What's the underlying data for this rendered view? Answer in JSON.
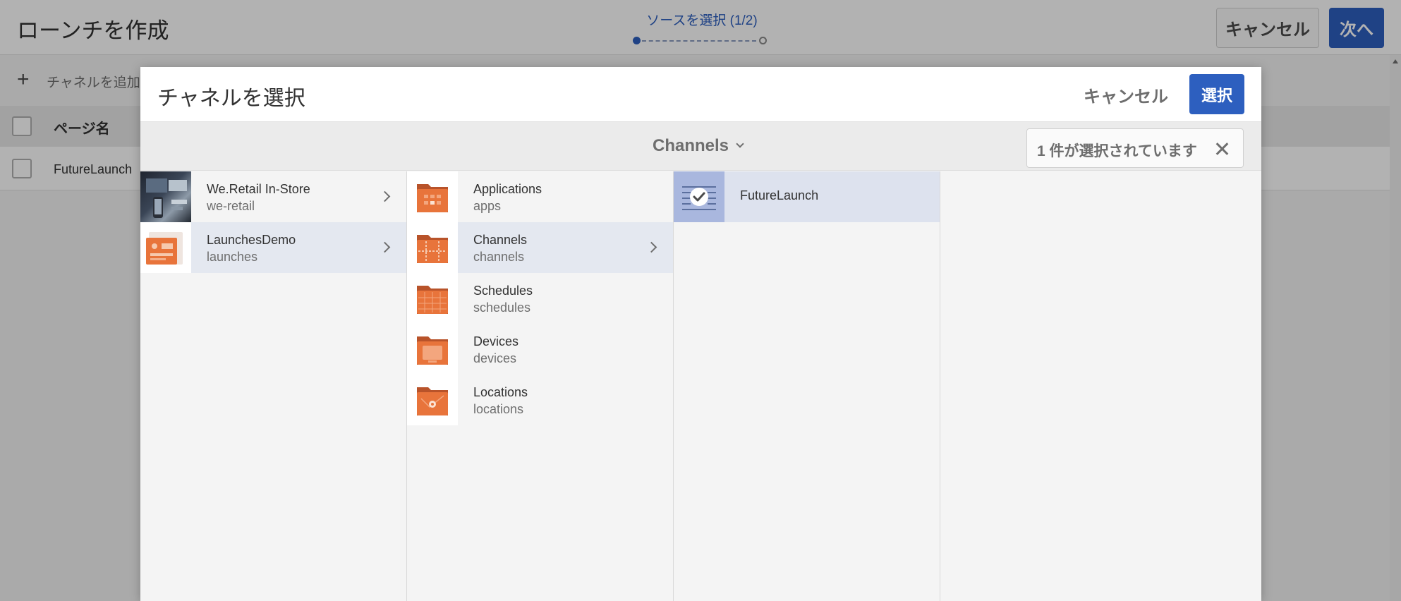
{
  "page": {
    "title": "ローンチを作成",
    "wizard": {
      "step_label": "ソースを選択 (1/2)"
    },
    "cancel_label": "キャンセル",
    "next_label": "次へ",
    "add_channel_label": "チャネルを追加",
    "table": {
      "header_name": "ページ名",
      "rows": [
        {
          "name": "FutureLaunch"
        }
      ]
    }
  },
  "dialog": {
    "title": "チャネルを選択",
    "cancel_label": "キャンセル",
    "select_label": "選択",
    "breadcrumb": "Channels",
    "selection_count": "1 件が選択されています",
    "columns": [
      [
        {
          "title": "We.Retail In-Store",
          "sub": "we-retail",
          "icon": "site-photo-thumbnail"
        },
        {
          "title": "LaunchesDemo",
          "sub": "launches",
          "icon": "site-thumbnail"
        }
      ],
      [
        {
          "title": "Applications",
          "sub": "apps",
          "icon": "folder-icon"
        },
        {
          "title": "Channels",
          "sub": "channels",
          "icon": "folder-icon"
        },
        {
          "title": "Schedules",
          "sub": "schedules",
          "icon": "folder-icon"
        },
        {
          "title": "Devices",
          "sub": "devices",
          "icon": "folder-icon"
        },
        {
          "title": "Locations",
          "sub": "locations",
          "icon": "folder-icon"
        }
      ],
      [
        {
          "title": "FutureLaunch",
          "icon": "checkmark-icon"
        }
      ]
    ]
  },
  "colors": {
    "accent": "#2d5fbf",
    "folder": "#e8743b",
    "selected_row": "#dde2ee",
    "overlay": "rgba(0,0,0,0.30)"
  }
}
